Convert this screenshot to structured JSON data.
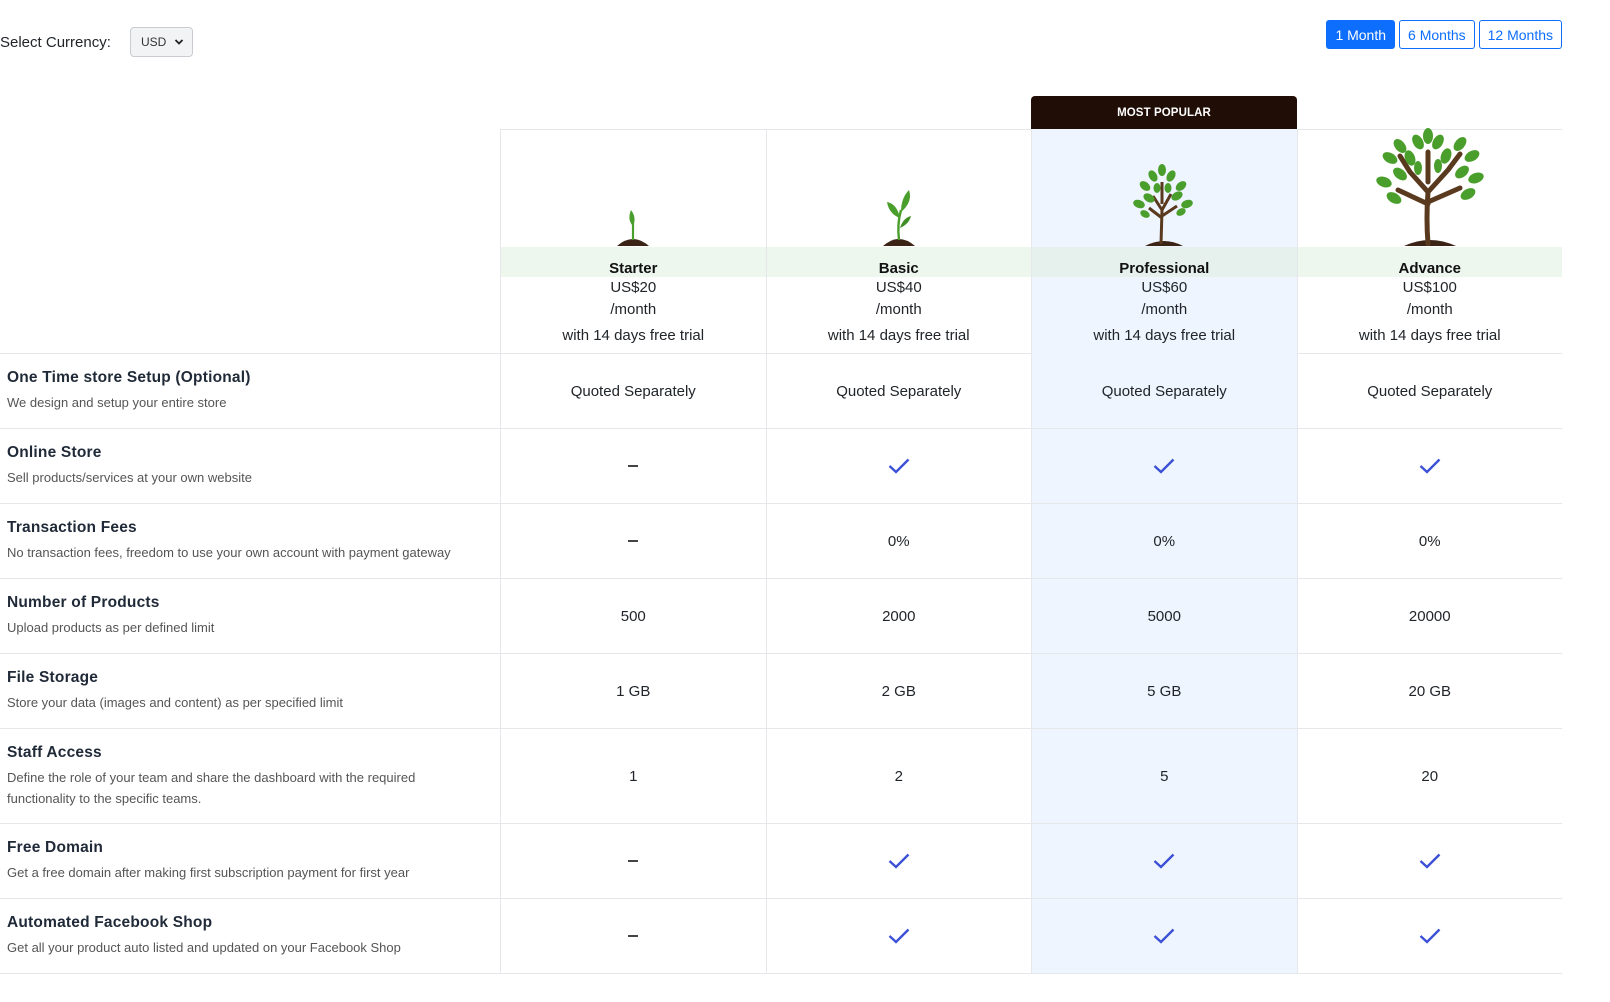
{
  "currency": {
    "label": "Select Currency:",
    "selected": "USD"
  },
  "periods": [
    {
      "label": "1 Month",
      "active": true
    },
    {
      "label": "6 Months",
      "active": false
    },
    {
      "label": "12 Months",
      "active": false
    }
  ],
  "badge": "MOST POPULAR",
  "plans": [
    {
      "name": "Starter",
      "price": "US$20",
      "per": "/month",
      "trial": "with 14 days free trial",
      "icon": "sprout-icon"
    },
    {
      "name": "Basic",
      "price": "US$40",
      "per": "/month",
      "trial": "with 14 days free trial",
      "icon": "seedling-icon"
    },
    {
      "name": "Professional",
      "price": "US$60",
      "per": "/month",
      "trial": "with 14 days free trial",
      "icon": "small-tree-icon"
    },
    {
      "name": "Advance",
      "price": "US$100",
      "per": "/month",
      "trial": "with 14 days free trial",
      "icon": "large-tree-icon"
    }
  ],
  "features": [
    {
      "title": "One Time store Setup (Optional)",
      "desc": "We design and setup your entire store",
      "values": [
        "Quoted Separately",
        "Quoted Separately",
        "Quoted Separately",
        "Quoted Separately"
      ]
    },
    {
      "title": "Online Store",
      "desc": "Sell products/services at your own website",
      "values": [
        "–",
        "check",
        "check",
        "check"
      ]
    },
    {
      "title": "Transaction Fees",
      "desc": "No transaction fees, freedom to use your own account with payment gateway",
      "values": [
        "–",
        "0%",
        "0%",
        "0%"
      ]
    },
    {
      "title": "Number of Products",
      "desc": "Upload products as per defined limit",
      "values": [
        "500",
        "2000",
        "5000",
        "20000"
      ]
    },
    {
      "title": "File Storage",
      "desc": "Store your data (images and content) as per specified limit",
      "values": [
        "1 GB",
        "2 GB",
        "5 GB",
        "20 GB"
      ]
    },
    {
      "title": "Staff Access",
      "desc": "Define the role of your team and share the dashboard with the required functionality to the specific teams.",
      "values": [
        "1",
        "2",
        "5",
        "20"
      ]
    },
    {
      "title": "Free Domain",
      "desc": "Get a free domain after making first subscription payment for first year",
      "values": [
        "–",
        "check",
        "check",
        "check"
      ]
    },
    {
      "title": "Automated Facebook Shop",
      "desc": "Get all your product auto listed and updated on your Facebook Shop",
      "values": [
        "–",
        "check",
        "check",
        "check"
      ]
    }
  ],
  "colors": {
    "accent": "#0d6efd",
    "check": "#3b50d6",
    "highlight": "#eff5fe",
    "badge_bg": "#200d05",
    "leaf": "#4a9e2b",
    "trunk": "#5a3a1e"
  }
}
